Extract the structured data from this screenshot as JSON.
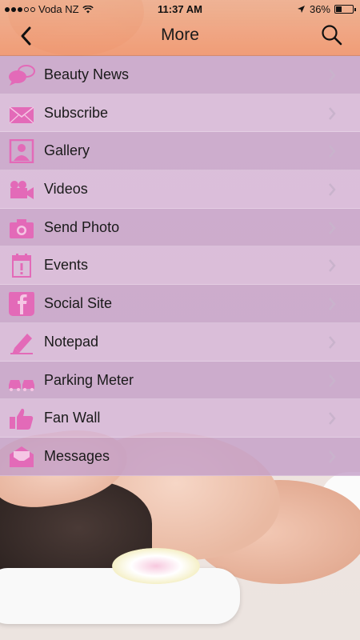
{
  "status_bar": {
    "carrier": "Voda NZ",
    "time": "11:37 AM",
    "battery": "36%",
    "battery_level": 0.36
  },
  "nav": {
    "title": "More",
    "back_icon": "chevron-left-icon",
    "search_icon": "search-icon"
  },
  "menu": {
    "items": [
      {
        "label": "Beauty News",
        "icon": "chat-bubbles-icon"
      },
      {
        "label": "Subscribe",
        "icon": "envelope-icon"
      },
      {
        "label": "Gallery",
        "icon": "portrait-icon"
      },
      {
        "label": "Videos",
        "icon": "video-camera-icon"
      },
      {
        "label": "Send Photo",
        "icon": "camera-icon"
      },
      {
        "label": "Events",
        "icon": "calendar-icon"
      },
      {
        "label": "Social Site",
        "icon": "facebook-icon"
      },
      {
        "label": "Notepad",
        "icon": "pencil-icon"
      },
      {
        "label": "Parking Meter",
        "icon": "cars-icon"
      },
      {
        "label": "Fan Wall",
        "icon": "thumbs-up-icon"
      },
      {
        "label": "Messages",
        "icon": "open-envelope-icon"
      }
    ]
  },
  "colors": {
    "header": "#ef9c74",
    "menu_row_dark": "#c4a0c8",
    "menu_row_light": "#d6b6d8",
    "icon_pink": "#e36ab8"
  }
}
